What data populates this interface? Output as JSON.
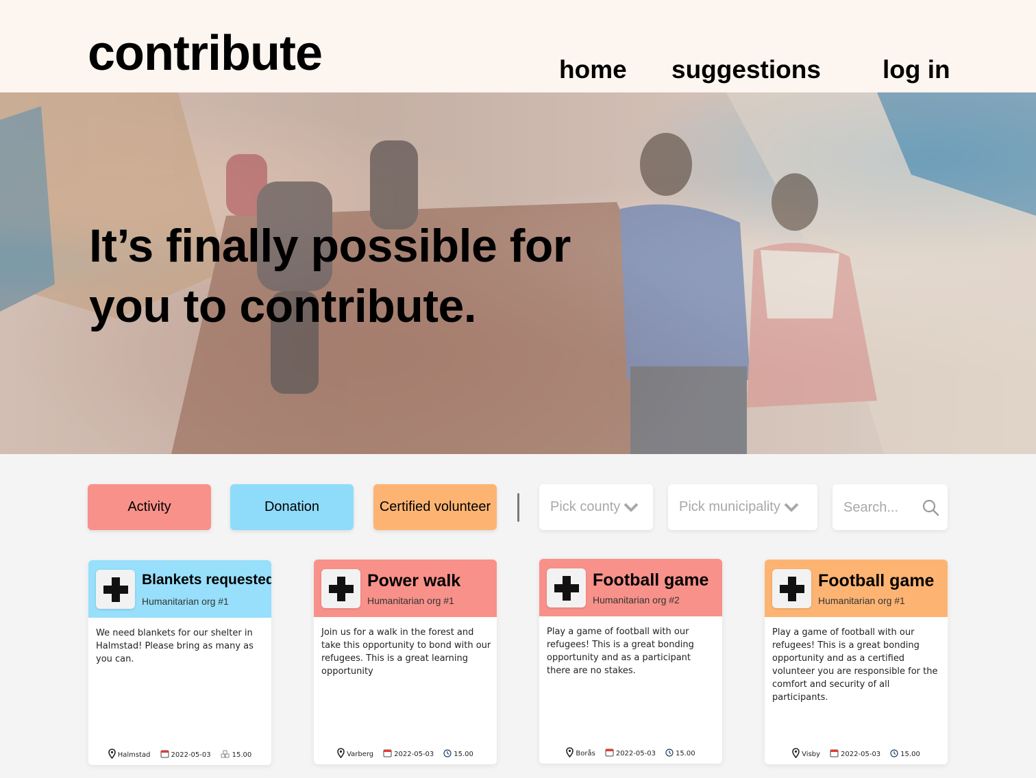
{
  "header": {
    "logo": "contribute",
    "nav": {
      "home": "home",
      "suggestions": "suggestions",
      "login": "log in"
    }
  },
  "hero": {
    "line1": "It’s finally possible for",
    "line2": "you to contribute."
  },
  "filters": {
    "activity": "Activity",
    "donation": "Donation",
    "certified": "Certified volunteer",
    "county": "Pick county",
    "municipality": "Pick municipality",
    "search_placeholder": "Search..."
  },
  "colors": {
    "header_bg": "#fdf5ef",
    "activity": "#f8918a",
    "donation": "#8fdcfa",
    "certified": "#fdb473"
  },
  "cards": [
    {
      "title": "Blankets requested",
      "org": "Humanitarian org #1",
      "description": "We need blankets for our shelter in Halmstad! Please bring as many as you can.",
      "location": "Halmstad",
      "date": "2022-05-03",
      "extra": "15.00",
      "extra_icon": "boxes-icon"
    },
    {
      "title": "Power walk",
      "org": "Humanitarian org #1",
      "description": "Join us for a walk in the forest and take this opportunity to bond with our refugees. This is a great learning opportunity",
      "location": "Varberg",
      "date": "2022-05-03",
      "extra": "15.00",
      "extra_icon": "clock-icon"
    },
    {
      "title": "Football game",
      "org": "Humanitarian org #2",
      "description": "Play a game of football with our refugees! This is a great bonding opportunity and as a participant there are no stakes.",
      "location": "Borås",
      "date": "2022-05-03",
      "extra": "15.00",
      "extra_icon": "clock-icon"
    },
    {
      "title": "Football game",
      "org": "Humanitarian org #1",
      "description": "Play a game of football with our refugees! This is a great bonding opportunity and as a certified volunteer you are responsible for the comfort and security of all participants.",
      "location": "Visby",
      "date": "2022-05-03",
      "extra": "15.00",
      "extra_icon": "clock-icon"
    }
  ]
}
